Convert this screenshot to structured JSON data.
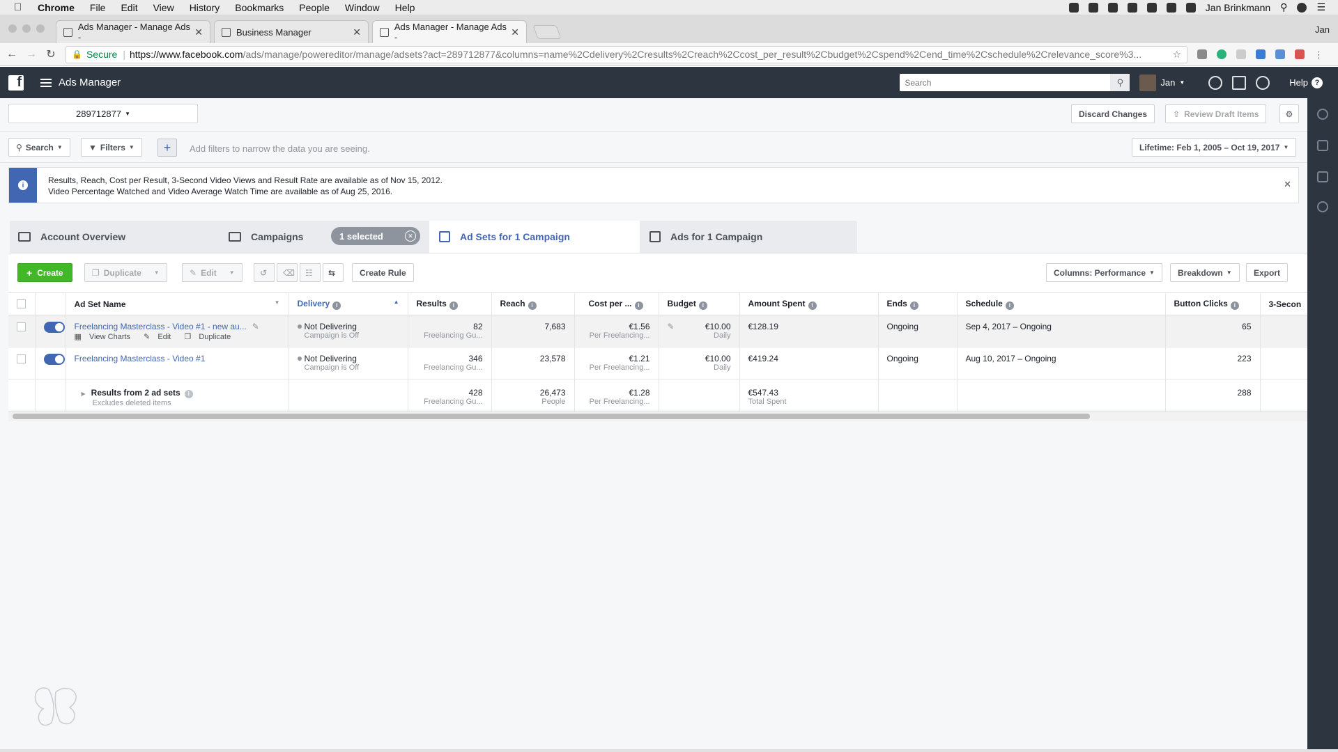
{
  "menubar": {
    "items": [
      "Chrome",
      "File",
      "Edit",
      "View",
      "History",
      "Bookmarks",
      "People",
      "Window",
      "Help"
    ],
    "user": "Jan Brinkmann"
  },
  "browser": {
    "tabs": [
      {
        "title": "Ads Manager - Manage Ads -"
      },
      {
        "title": "Business Manager"
      },
      {
        "title": "Ads Manager - Manage Ads -"
      }
    ],
    "profile": "Jan",
    "secure_label": "Secure",
    "url_host": "https://www.facebook.com",
    "url_path": "/ads/manage/powereditor/manage/adsets?act=289712877&columns=name%2Cdelivery%2Cresults%2Creach%2Ccost_per_result%2Cbudget%2Cspend%2Cend_time%2Cschedule%2Crelevance_score%3..."
  },
  "fbbar": {
    "title": "Ads Manager",
    "search_placeholder": "Search",
    "user": "Jan",
    "help": "Help"
  },
  "toolbar": {
    "account": "289712877",
    "discard": "Discard Changes",
    "review": "Review Draft Items",
    "search": "Search",
    "filters": "Filters",
    "filter_hint": "Add filters to narrow the data you are seeing.",
    "date_range": "Lifetime: Feb 1, 2005 – Oct 19, 2017"
  },
  "notice": {
    "line1": "Results, Reach, Cost per Result, 3-Second Video Views and Result Rate are available as of Nov 15, 2012.",
    "line2": "Video Percentage Watched and Video Average Watch Time are available as of Aug 25, 2016."
  },
  "view_tabs": {
    "account_overview": "Account Overview",
    "campaigns": "Campaigns",
    "selected": "1 selected",
    "adsets": "Ad Sets for 1 Campaign",
    "ads": "Ads for 1 Campaign"
  },
  "actions": {
    "create": "Create",
    "duplicate": "Duplicate",
    "edit": "Edit",
    "create_rule": "Create Rule",
    "columns": "Columns: Performance",
    "breakdown": "Breakdown",
    "export": "Export"
  },
  "table": {
    "headers": [
      "Ad Set Name",
      "Delivery",
      "Results",
      "Reach",
      "Cost per ...",
      "Budget",
      "Amount Spent",
      "Ends",
      "Schedule",
      "Button Clicks",
      "3-Secon"
    ],
    "rows": [
      {
        "name": "Freelancing Masterclass - Video #1 - new au...",
        "actions": [
          "View Charts",
          "Edit",
          "Duplicate"
        ],
        "delivery": "Not Delivering",
        "delivery_sub": "Campaign is Off",
        "results": "82",
        "results_sub": "Freelancing Gu...",
        "reach": "7,683",
        "cost": "€1.56",
        "cost_sub": "Per Freelancing...",
        "budget": "€10.00",
        "budget_sub": "Daily",
        "spent": "€128.19",
        "ends": "Ongoing",
        "schedule": "Sep 4, 2017 – Ongoing",
        "clicks": "65"
      },
      {
        "name": "Freelancing Masterclass - Video #1",
        "delivery": "Not Delivering",
        "delivery_sub": "Campaign is Off",
        "results": "346",
        "results_sub": "Freelancing Gu...",
        "reach": "23,578",
        "cost": "€1.21",
        "cost_sub": "Per Freelancing...",
        "budget": "€10.00",
        "budget_sub": "Daily",
        "spent": "€419.24",
        "ends": "Ongoing",
        "schedule": "Aug 10, 2017 – Ongoing",
        "clicks": "223"
      }
    ],
    "totals": {
      "label": "Results from 2 ad sets",
      "label_sub": "Excludes deleted items",
      "results": "428",
      "results_sub": "Freelancing Gu...",
      "reach": "26,473",
      "reach_sub": "People",
      "cost": "€1.28",
      "cost_sub": "Per Freelancing...",
      "spent": "€547.43",
      "spent_sub": "Total Spent",
      "clicks": "288"
    }
  }
}
